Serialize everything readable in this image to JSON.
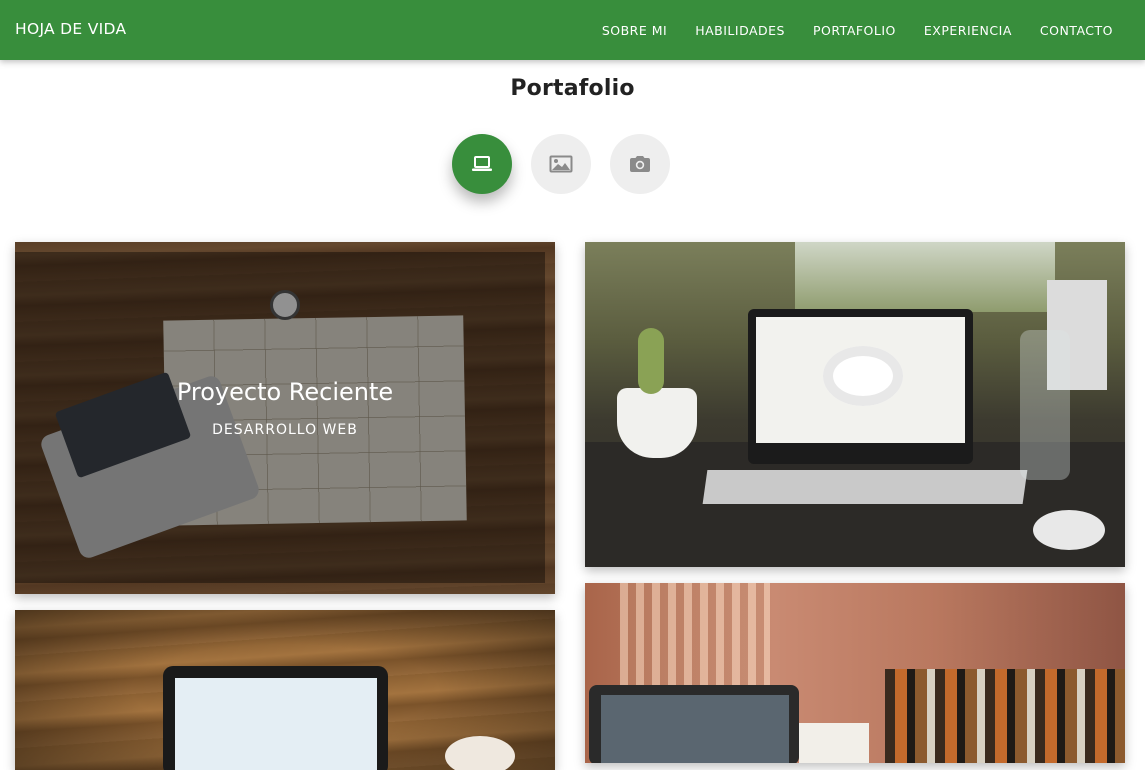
{
  "navbar": {
    "brand": "HOJA DE VIDA",
    "links": [
      "SOBRE MI",
      "HABILIDADES",
      "PORTAFOLIO",
      "EXPERIENCIA",
      "CONTACTO"
    ],
    "background_color": "#388e3c"
  },
  "portfolio": {
    "title": "Portafolio",
    "filters": [
      {
        "icon": "laptop-icon",
        "active": true
      },
      {
        "icon": "image-icon",
        "active": false
      },
      {
        "icon": "camera-icon",
        "active": false
      }
    ],
    "active_color": "#388e3c",
    "inactive_color": "#eeeeee",
    "projects": [
      {
        "title": "Proyecto Reciente",
        "category": "DESARROLLO WEB",
        "hovered": true
      },
      {
        "hovered": false
      },
      {
        "hovered": false
      },
      {
        "hovered": false
      }
    ]
  }
}
